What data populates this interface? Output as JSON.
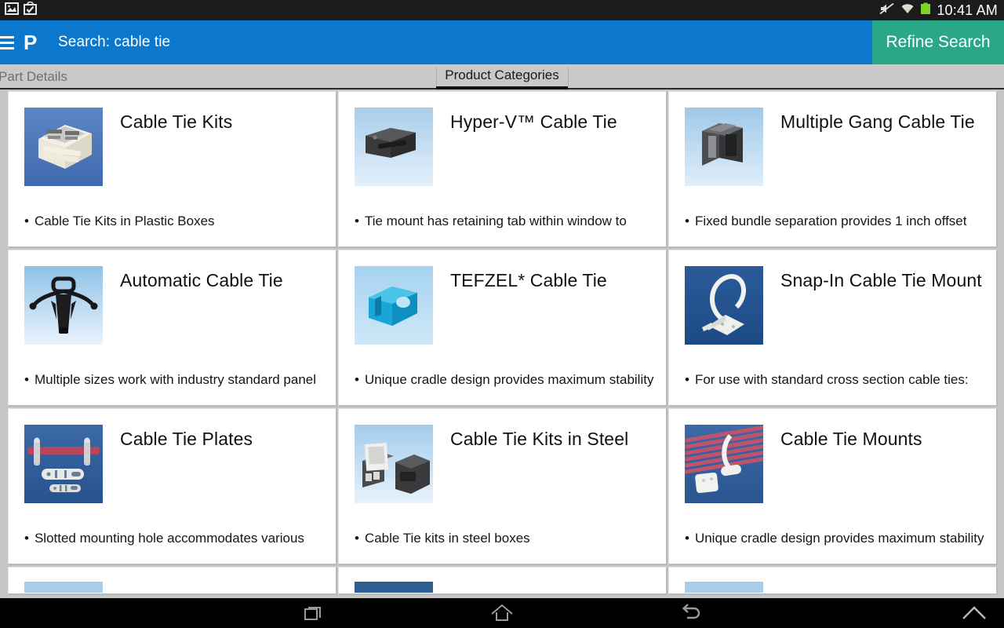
{
  "statusbar": {
    "left_icons": [
      "screenshot-image-icon",
      "app-install-bag-icon"
    ],
    "right_icons": [
      "mute-icon",
      "wifi-icon",
      "battery-icon"
    ],
    "clock": "10:41 AM"
  },
  "appbar": {
    "menu_icon": "hamburger-menu-icon",
    "logo": "panduit-p-logo",
    "search_label": "Search: cable tie",
    "refine_label": "Refine Search",
    "blue": "#0b78ce",
    "teal": "#2aa789"
  },
  "tabs": [
    {
      "label": "Part Details",
      "active": false
    },
    {
      "label": "Product Categories",
      "active": true
    }
  ],
  "cards": [
    {
      "title": "Cable Tie Kits",
      "bullet": "Cable Tie Kits in Plastic Boxes",
      "thumb": "cable-tie-kit-plastic-box-thumbnail"
    },
    {
      "title": "Hyper-V™ Cable Tie",
      "bullet": "Tie mount has retaining tab within window to",
      "thumb": "hyper-v-cable-tie-thumbnail"
    },
    {
      "title": "Multiple Gang Cable Tie",
      "bullet": "Fixed bundle separation provides 1 inch offset",
      "thumb": "multiple-gang-cable-tie-thumbnail"
    },
    {
      "title": "Automatic Cable Tie",
      "bullet": "Multiple sizes work with industry standard panel",
      "thumb": "automatic-cable-tie-thumbnail"
    },
    {
      "title": "TEFZEL* Cable Tie",
      "bullet": "Unique cradle design provides maximum stability",
      "thumb": "tefzel-cable-tie-thumbnail"
    },
    {
      "title": "Snap-In Cable Tie Mount",
      "bullet": "For use with standard cross section cable ties:",
      "thumb": "snap-in-cable-tie-mount-thumbnail"
    },
    {
      "title": "Cable Tie Plates",
      "bullet": "Slotted mounting hole accommodates various",
      "thumb": "cable-tie-plates-thumbnail"
    },
    {
      "title": "Cable Tie Kits in Steel",
      "bullet": "Cable Tie kits in steel boxes",
      "thumb": "cable-tie-kits-steel-thumbnail"
    },
    {
      "title": "Cable Tie Mounts",
      "bullet": "Unique cradle design provides maximum stability",
      "thumb": "cable-tie-mounts-thumbnail"
    }
  ],
  "navbar": {
    "recents_icon": "recents-icon",
    "home_icon": "home-icon",
    "back_icon": "back-icon",
    "up_icon": "chevron-up-icon"
  }
}
